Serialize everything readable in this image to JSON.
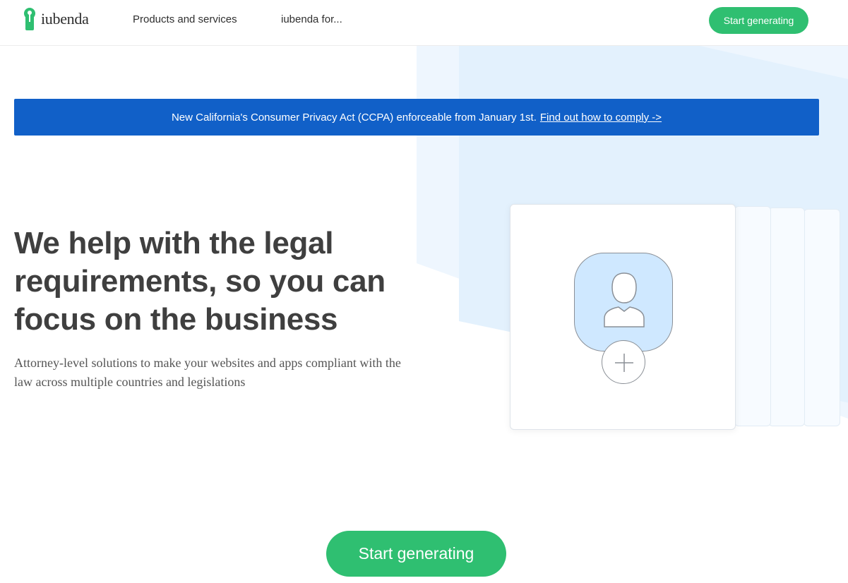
{
  "header": {
    "logo_text": "iubenda",
    "nav": [
      {
        "label": "Products and services"
      },
      {
        "label": "iubenda for..."
      }
    ],
    "cta_label": "Start generating"
  },
  "banner": {
    "text": "New California's Consumer Privacy Act (CCPA) enforceable from January 1st.",
    "link_text": "Find out how to comply ->"
  },
  "hero": {
    "title": "We help with the legal requirements, so you can focus on the business",
    "subtitle": "Attorney-level solutions to make your websites and apps compliant with the law across multiple countries and legislations",
    "cta_label": "Start generating"
  },
  "illustration": {
    "avatar_icon": "user-icon",
    "add_icon": "plus-icon"
  },
  "colors": {
    "brand_green": "#2fbf71",
    "banner_blue": "#1160c8",
    "avatar_bg": "#cfe8ff",
    "bg_light_blue": "#e3f1fd"
  }
}
